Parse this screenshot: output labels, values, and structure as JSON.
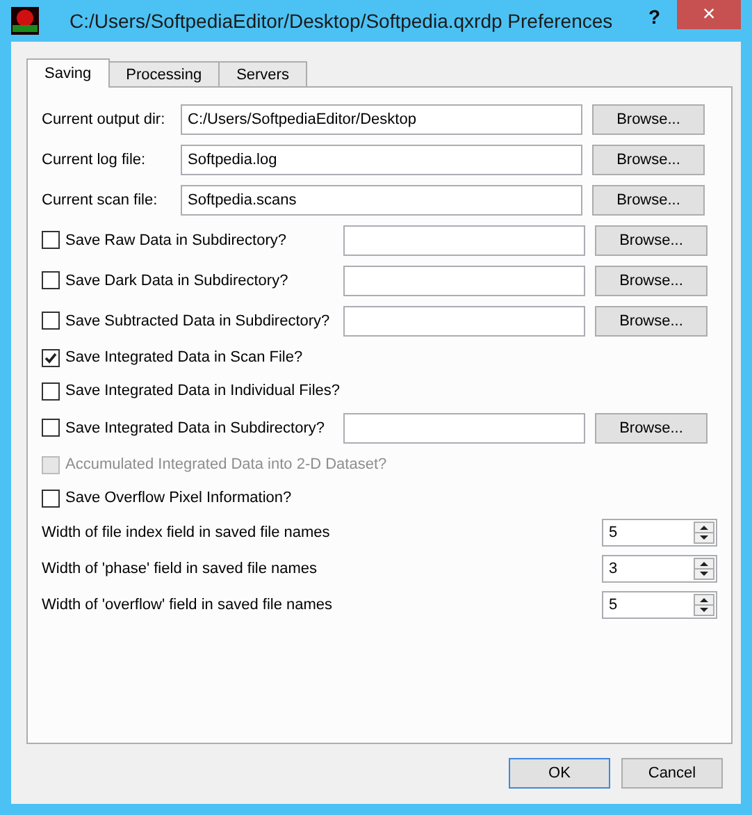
{
  "window": {
    "title": "C:/Users/SoftpediaEditor/Desktop/Softpedia.qxrdp Preferences",
    "help": "?",
    "close": "×"
  },
  "tabs": [
    {
      "label": "Saving",
      "selected": true
    },
    {
      "label": "Processing",
      "selected": false
    },
    {
      "label": "Servers",
      "selected": false
    }
  ],
  "rows": [
    {
      "kind": "path",
      "label": "Current output dir:",
      "value": "C:/Users/SoftpediaEditor/Desktop",
      "button": "Browse..."
    },
    {
      "kind": "path",
      "label": "Current log file:",
      "value": "Softpedia.log",
      "button": "Browse..."
    },
    {
      "kind": "path",
      "label": "Current scan file:",
      "value": "Softpedia.scans",
      "button": "Browse..."
    },
    {
      "kind": "check_path",
      "label": "Save Raw Data in Subdirectory?",
      "checked": false,
      "button": "Browse..."
    },
    {
      "kind": "check_path",
      "label": "Save Dark Data in Subdirectory?",
      "checked": false,
      "button": "Browse..."
    },
    {
      "kind": "check_path",
      "label": "Save Subtracted Data in Subdirectory?",
      "checked": false,
      "button": "Browse..."
    },
    {
      "kind": "check",
      "label": "Save Integrated Data in Scan File?",
      "checked": true,
      "disabled": false
    },
    {
      "kind": "check",
      "label": "Save Integrated Data in Individual Files?",
      "checked": false,
      "disabled": false
    },
    {
      "kind": "check_path",
      "label": "Save Integrated Data in Subdirectory?",
      "checked": false,
      "button": "Browse..."
    },
    {
      "kind": "check",
      "label": "Accumulated Integrated Data into 2-D Dataset?",
      "checked": false,
      "disabled": true
    },
    {
      "kind": "check",
      "label": "Save Overflow Pixel Information?",
      "checked": false,
      "disabled": false
    },
    {
      "kind": "spin",
      "label": "Width of file index field in saved file names",
      "value": "5"
    },
    {
      "kind": "spin",
      "label": "Width of 'phase' field in saved file names",
      "value": "3"
    },
    {
      "kind": "spin",
      "label": "Width of 'overflow' field in saved file names",
      "value": "5"
    }
  ],
  "buttons": [
    {
      "label": "OK",
      "default": true
    },
    {
      "label": "Cancel",
      "default": false
    }
  ]
}
